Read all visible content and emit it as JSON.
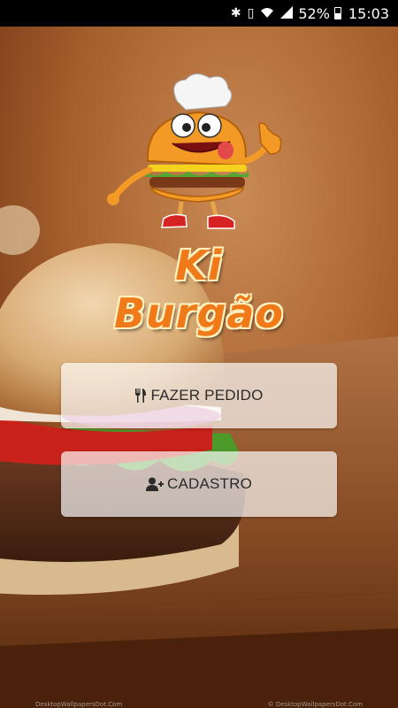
{
  "status_bar": {
    "icons": [
      "bluetooth-icon",
      "vibrate-icon",
      "wifi-icon",
      "signal-icon"
    ],
    "battery_percent": "52%",
    "time": "15:03"
  },
  "brand": {
    "name": "Ki Burgão",
    "mascot": "burger-chef-mascot"
  },
  "buttons": {
    "order": {
      "label": "FAZER PEDIDO",
      "icon": "utensils-icon"
    },
    "register": {
      "label": "CADASTRO",
      "icon": "user-plus-icon"
    }
  },
  "watermark": {
    "left": "DesktopWallpapersDot.Com",
    "right": "© DesktopWallpapersDot.Com"
  }
}
